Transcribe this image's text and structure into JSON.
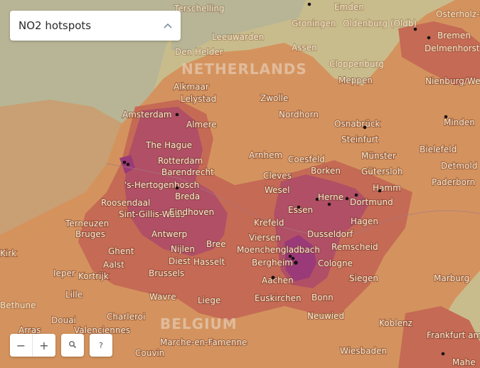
{
  "selector": {
    "value": "NO2 hotspots",
    "icon": "chevron-up"
  },
  "controls": {
    "zoom_out": "−",
    "zoom_in": "+",
    "search_icon": "magnifier",
    "help": "?"
  },
  "map": {
    "colors": {
      "water": "#b7b595",
      "land": "#c9bc8c",
      "low": "#d4935e",
      "medium": "#c56a55",
      "high": "#b04f66",
      "very_high": "#9a3a78"
    },
    "countries": [
      "NETHERLANDS",
      "BELGIUM"
    ],
    "cities": [
      "Terschelling",
      "Emden",
      "Groningen",
      "Oldenburg (Oldb)",
      "Osterholz-Scharmbeck",
      "Bremen",
      "Delmenhorst",
      "Leeuwarden",
      "Assen",
      "Cloppenburg",
      "Den Helder",
      "Meppen",
      "Nienburg/Weser",
      "Alkmaar",
      "Lelystad",
      "Zwolle",
      "Nordhorn",
      "Amsterdam",
      "Almere",
      "Osnabrück",
      "Minden",
      "Steinfurt",
      "Bielefeld",
      "The Hague",
      "Rotterdam",
      "Arnhem",
      "Coesfeld",
      "Münster",
      "Detmold",
      "Barendrecht",
      "Borken",
      "Gütersloh",
      "'s-Hertogenbosch",
      "Cleves",
      "Hamm",
      "Paderborn",
      "Breda",
      "Wesel",
      "Herne",
      "Roosendaal",
      "Dortmund",
      "Essen",
      "Sint-Gillis-Waas",
      "Eindhoven",
      "Hagen",
      "Terneuzen",
      "Bruges",
      "Krefeld",
      "Antwerp",
      "Dusseldorf",
      "Viersen",
      "Nijlen",
      "Remscheid",
      "Ghent",
      "Moenchengladbach",
      "Bree",
      "Aalst",
      "Diest",
      "Hasselt",
      "Bergheim",
      "Cologne",
      "Kortrijk",
      "Brussels",
      "Ieper",
      "Aachen",
      "Siegen",
      "Lille",
      "Wavre",
      "Liege",
      "Euskirchen",
      "Bonn",
      "Marburg",
      "Neuwied",
      "Douai",
      "Charleroi",
      "Koblenz",
      "Arras",
      "Valenciennes",
      "Marche-en-Famenne",
      "Wiesbaden",
      "Frankfurt am Main",
      "Couvin",
      "Kirk",
      "Mahe",
      "Bethune"
    ],
    "hotspots": [
      "Amsterdam",
      "The Hague",
      "Rotterdam",
      "Dortmund",
      "Herne",
      "Essen",
      "Hamm",
      "Moenchengladbach",
      "Cologne",
      "Aachen",
      "Osnabrück",
      "Minden",
      "Bremen",
      "Emden",
      "Frankfurt am Main",
      "Eindhoven",
      "Bielefeld"
    ]
  }
}
